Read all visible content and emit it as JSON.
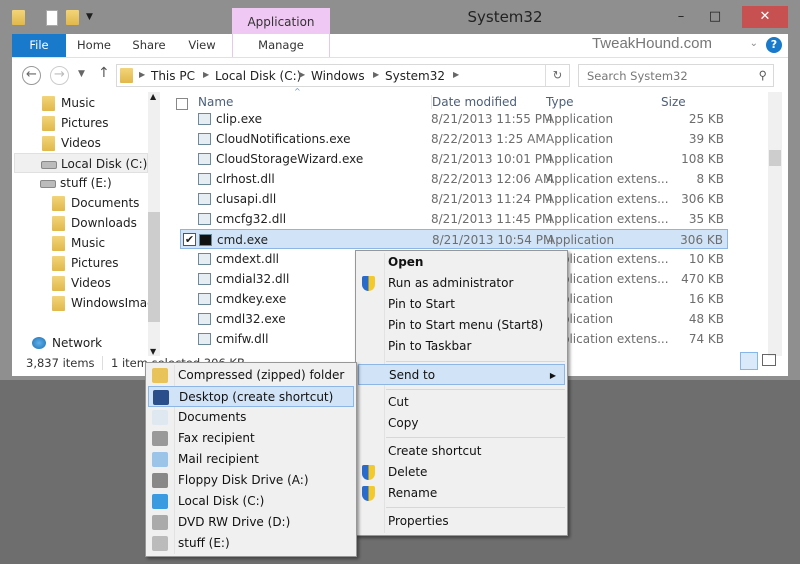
{
  "window": {
    "title": "System32",
    "context_tab_group": "Application Tools",
    "brand": "TweakHound.com",
    "accent": "#1979ca",
    "close_color": "#c75050"
  },
  "ribbon": {
    "tabs": [
      "File",
      "Home",
      "Share",
      "View",
      "Manage"
    ]
  },
  "address": {
    "crumbs": [
      "This PC",
      "Local Disk (C:)",
      "Windows",
      "System32"
    ],
    "search_placeholder": "Search System32"
  },
  "nav": {
    "items": [
      {
        "label": "Music",
        "icon": "music-folder-icon"
      },
      {
        "label": "Pictures",
        "icon": "pictures-folder-icon"
      },
      {
        "label": "Videos",
        "icon": "videos-folder-icon"
      },
      {
        "label": "Local Disk (C:)",
        "icon": "drive-icon",
        "selected": true
      },
      {
        "label": "stuff (E:)",
        "icon": "drive-icon"
      },
      {
        "label": "Documents",
        "icon": "folder-icon"
      },
      {
        "label": "Downloads",
        "icon": "folder-icon"
      },
      {
        "label": "Music",
        "icon": "folder-icon"
      },
      {
        "label": "Pictures",
        "icon": "folder-icon"
      },
      {
        "label": "Videos",
        "icon": "folder-icon"
      },
      {
        "label": "WindowsImage",
        "icon": "folder-icon"
      },
      {
        "label": "Network",
        "icon": "network-icon"
      }
    ]
  },
  "columns": [
    "Name",
    "Date modified",
    "Type",
    "Size"
  ],
  "files": [
    {
      "name": "clip.exe",
      "date": "8/21/2013 11:55 PM",
      "type": "Application",
      "size": "25 KB"
    },
    {
      "name": "CloudNotifications.exe",
      "date": "8/22/2013 1:25 AM",
      "type": "Application",
      "size": "39 KB"
    },
    {
      "name": "CloudStorageWizard.exe",
      "date": "8/21/2013 10:01 PM",
      "type": "Application",
      "size": "108 KB"
    },
    {
      "name": "clrhost.dll",
      "date": "8/22/2013 12:06 AM",
      "type": "Application extens...",
      "size": "8 KB"
    },
    {
      "name": "clusapi.dll",
      "date": "8/21/2013 11:24 PM",
      "type": "Application extens...",
      "size": "306 KB"
    },
    {
      "name": "cmcfg32.dll",
      "date": "8/21/2013 11:45 PM",
      "type": "Application extens...",
      "size": "35 KB"
    },
    {
      "name": "cmd.exe",
      "date": "8/21/2013 10:54 PM",
      "type": "Application",
      "size": "306 KB",
      "selected": true
    },
    {
      "name": "cmdext.dll",
      "date": "",
      "type": "Application extens...",
      "size": "10 KB"
    },
    {
      "name": "cmdial32.dll",
      "date": "",
      "type": "Application extens...",
      "size": "470 KB"
    },
    {
      "name": "cmdkey.exe",
      "date": "",
      "type": "Application",
      "size": "16 KB"
    },
    {
      "name": "cmdl32.exe",
      "date": "",
      "type": "Application",
      "size": "48 KB"
    },
    {
      "name": "cmifw.dll",
      "date": "",
      "type": "Application extens...",
      "size": "74 KB"
    }
  ],
  "status": {
    "count": "3,837 items",
    "selection": "1 item selected  306 KB"
  },
  "context_menu": {
    "items": [
      "Open",
      "Run as administrator",
      "Pin to Start",
      "Pin to Start menu (Start8)",
      "Pin to Taskbar",
      "Send to",
      "Cut",
      "Copy",
      "Create shortcut",
      "Delete",
      "Rename",
      "Properties"
    ]
  },
  "send_to_menu": {
    "items": [
      "Compressed (zipped) folder",
      "Desktop (create shortcut)",
      "Documents",
      "Fax recipient",
      "Mail recipient",
      "Floppy Disk Drive (A:)",
      "Local Disk (C:)",
      "DVD RW Drive (D:)",
      "stuff (E:)"
    ]
  }
}
